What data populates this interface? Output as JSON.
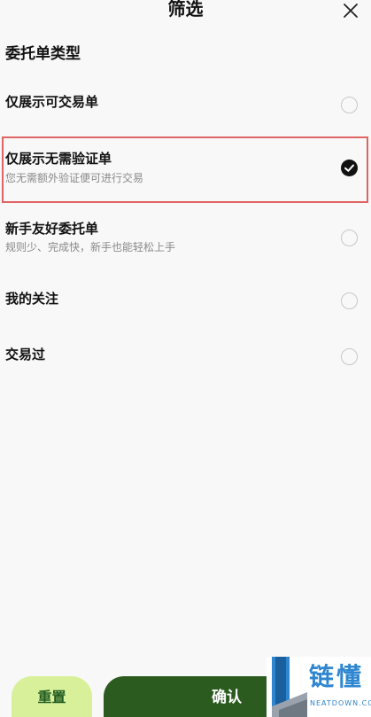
{
  "header": {
    "title": "筛选",
    "close_icon": "close-icon"
  },
  "section": {
    "title": "委托单类型"
  },
  "options": [
    {
      "label": "仅展示可交易单",
      "description": "",
      "checked": false
    },
    {
      "label": "仅展示无需验证单",
      "description": "您无需额外验证便可进行交易",
      "checked": true
    },
    {
      "label": "新手友好委托单",
      "description": "规则少、完成快，新手也能轻松上手",
      "checked": false
    },
    {
      "label": "我的关注",
      "description": "",
      "checked": false
    },
    {
      "label": "交易过",
      "description": "",
      "checked": false
    }
  ],
  "footer": {
    "reset_label": "重置",
    "confirm_label": "确认"
  },
  "watermark": {
    "text": "链懂",
    "subtext": "NEATDOWN.COM"
  },
  "colors": {
    "background": "#f8f8f8",
    "reset_button": "#d8f09a",
    "confirm_button": "#2b5b1f",
    "highlight_border": "#e06464",
    "check_fill": "#111111"
  }
}
